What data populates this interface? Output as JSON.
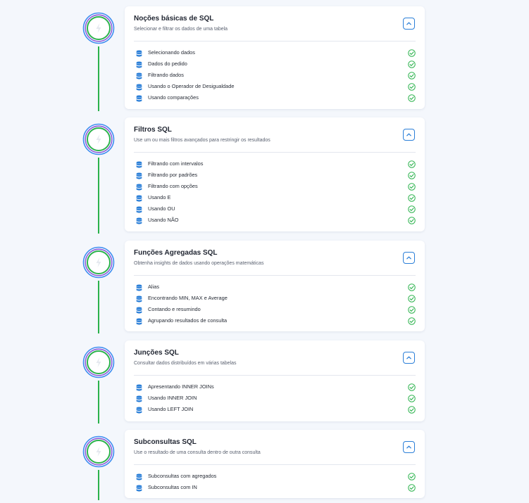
{
  "colors": {
    "background": "#f4f7fc",
    "accent_blue": "#2b7fd8",
    "success_green": "#2bb24c",
    "node_ring_blue": "#3f8ef0",
    "node_ring_purple": "#8a5cd8"
  },
  "icons": {
    "lesson": "database-icon",
    "status": "check-circle-icon",
    "toggle": "chevron-up-icon",
    "node": "lightning-icon"
  },
  "modules": [
    {
      "title": "Noções básicas de SQL",
      "subtitle": "Selecionar e filtrar os dados de uma tabela",
      "expanded": true,
      "lessons": [
        {
          "label": "Selecionando dados",
          "completed": true
        },
        {
          "label": "Dados do pedido",
          "completed": true
        },
        {
          "label": "Filtrando dados",
          "completed": true
        },
        {
          "label": "Usando o Operador de Desigualdade",
          "completed": true
        },
        {
          "label": "Usando comparações",
          "completed": true
        }
      ]
    },
    {
      "title": "Filtros SQL",
      "subtitle": "Use um ou mais filtros avançados para restringir os resultados",
      "expanded": true,
      "lessons": [
        {
          "label": "Filtrando com intervalos",
          "completed": true
        },
        {
          "label": "Filtrando por padrões",
          "completed": true
        },
        {
          "label": "Filtrando com opções",
          "completed": true
        },
        {
          "label": "Usando E",
          "completed": true
        },
        {
          "label": "Usando OU",
          "completed": true
        },
        {
          "label": "Usando NÃO",
          "completed": true
        }
      ]
    },
    {
      "title": "Funções Agregadas SQL",
      "subtitle": "Obtenha insights de dados usando operações matemáticas",
      "expanded": true,
      "lessons": [
        {
          "label": "Alias",
          "completed": true
        },
        {
          "label": "Encontrando MIN, MAX e Average",
          "completed": true
        },
        {
          "label": "Contando e resumindo",
          "completed": true
        },
        {
          "label": "Agrupando resultados de consulta",
          "completed": true
        }
      ]
    },
    {
      "title": "Junções SQL",
      "subtitle": "Consultar dados distribuídos em várias tabelas",
      "expanded": true,
      "lessons": [
        {
          "label": "Apresentando INNER JOINs",
          "completed": true
        },
        {
          "label": "Usando INNER JOIN",
          "completed": true
        },
        {
          "label": "Usando LEFT JOIN",
          "completed": true
        }
      ]
    },
    {
      "title": "Subconsultas SQL",
      "subtitle": "Use o resultado de uma consulta dentro de outra consulta",
      "expanded": true,
      "lessons": [
        {
          "label": "Subconsultas com agregados",
          "completed": true
        },
        {
          "label": "Subconsultas com IN",
          "completed": true
        }
      ]
    }
  ]
}
